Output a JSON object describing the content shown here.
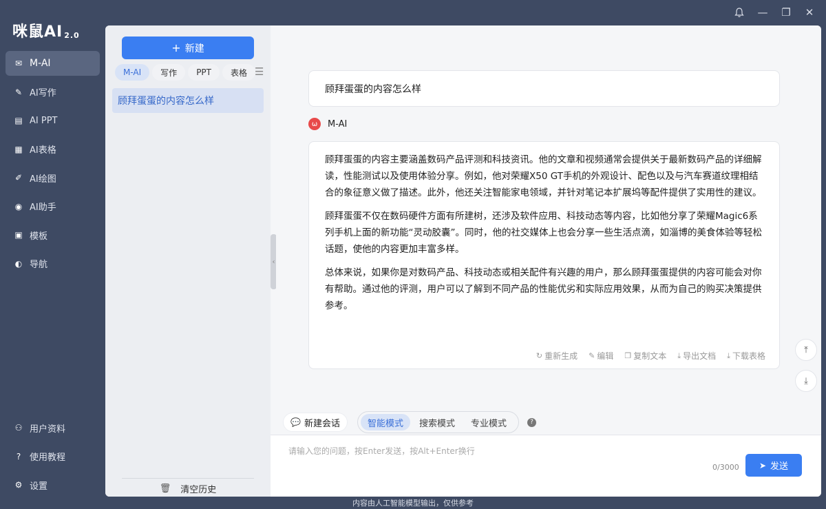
{
  "app": {
    "logo_text": "咪鼠AI",
    "logo_version": "2.0",
    "footer_note": "内容由人工智能模型输出，仅供参考"
  },
  "window_controls": {
    "bell_icon": "bell-icon",
    "minimize_glyph": "—",
    "restore_glyph": "❐",
    "close_glyph": "✕"
  },
  "nav": {
    "items": [
      {
        "label": "M-AI",
        "icon": "chat-icon",
        "glyph": "✉",
        "active": true
      },
      {
        "label": "AI写作",
        "icon": "writing-icon",
        "glyph": "✎"
      },
      {
        "label": "AI PPT",
        "icon": "ppt-icon",
        "glyph": "▤"
      },
      {
        "label": "AI表格",
        "icon": "table-icon",
        "glyph": "▦"
      },
      {
        "label": "AI绘图",
        "icon": "drawing-icon",
        "glyph": "✐"
      },
      {
        "label": "AI助手",
        "icon": "assistant-icon",
        "glyph": "◉"
      },
      {
        "label": "模板",
        "icon": "template-icon",
        "glyph": "▣"
      },
      {
        "label": "导航",
        "icon": "navigation-icon",
        "glyph": "◐"
      }
    ],
    "bottom": [
      {
        "label": "用户资料",
        "icon": "user-icon",
        "glyph": "⚇"
      },
      {
        "label": "使用教程",
        "icon": "help-icon",
        "glyph": "?"
      },
      {
        "label": "设置",
        "icon": "gear-icon",
        "glyph": "⚙"
      }
    ]
  },
  "history": {
    "new_label": "新建",
    "tabs": [
      "M-AI",
      "写作",
      "PPT",
      "表格"
    ],
    "items": [
      "顾拜蛋蛋的内容怎么样"
    ],
    "clear_label": "清空历史"
  },
  "chat": {
    "cut_text": "",
    "user_message": "顾拜蛋蛋的内容怎么样",
    "ai_name": "M-AI",
    "ai_paragraphs": [
      "顾拜蛋蛋的内容主要涵盖数码产品评测和科技资讯。他的文章和视频通常会提供关于最新数码产品的详细解读，性能测试以及使用体验分享。例如，他对荣耀X50 GT手机的外观设计、配色以及与汽车赛道纹理相结合的象征意义做了描述。此外，他还关注智能家电领域，并针对笔记本扩展坞等配件提供了实用性的建议。",
      "顾拜蛋蛋不仅在数码硬件方面有所建树，还涉及软件应用、科技动态等内容，比如他分享了荣耀Magic6系列手机上面的新功能“灵动胶囊”。同时，他的社交媒体上也会分享一些生活点滴，如淄博的美食体验等轻松话题，使他的内容更加丰富多样。",
      "总体来说，如果你是对数码产品、科技动态或相关配件有兴趣的用户，那么顾拜蛋蛋提供的内容可能会对你有帮助。通过他的评测，用户可以了解到不同产品的性能优劣和实际应用效果，从而为自己的购买决策提供参考。"
    ],
    "actions": [
      {
        "label": "重新生成",
        "icon": "refresh-icon",
        "glyph": "↻"
      },
      {
        "label": "编辑",
        "icon": "edit-icon",
        "glyph": "✎"
      },
      {
        "label": "复制文本",
        "icon": "copy-icon",
        "glyph": "❐"
      },
      {
        "label": "导出文档",
        "icon": "export-icon",
        "glyph": "⤓"
      },
      {
        "label": "下载表格",
        "icon": "download-icon",
        "glyph": "⤓"
      }
    ]
  },
  "mode_bar": {
    "new_chat_label": "新建会话",
    "modes": [
      "智能模式",
      "搜索模式",
      "专业模式"
    ],
    "active_mode": "智能模式"
  },
  "input": {
    "placeholder": "请输入您的问题，按Enter发送，按Alt+Enter换行",
    "counter": "0/3000",
    "send_label": "发送"
  },
  "colors": {
    "sidebar_bg": "#3e4a63",
    "accent": "#3a7ef2",
    "active_tab_bg": "#d8e3f7"
  }
}
